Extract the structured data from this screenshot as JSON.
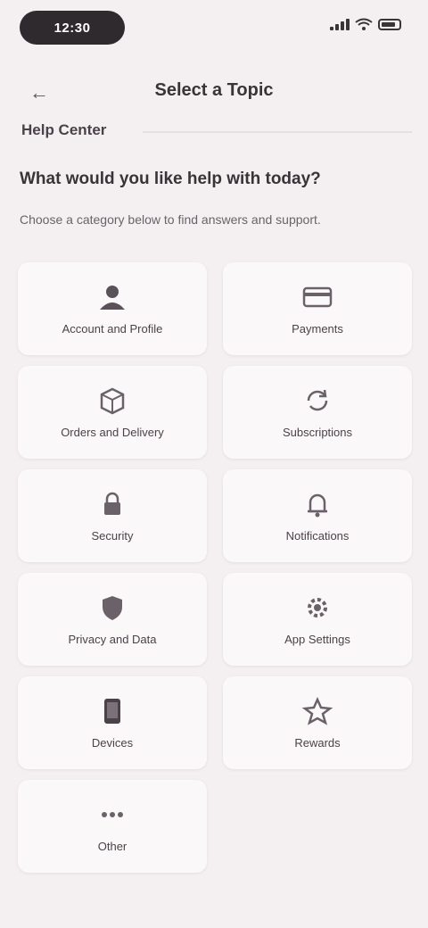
{
  "status": {
    "time": "12:30"
  },
  "nav": {
    "title": "Select a Topic"
  },
  "section": {
    "label": "Help Center"
  },
  "headline": "What would you like help with today?",
  "subline": "Choose a category below to find answers and support.",
  "topics": [
    {
      "label": "Account and Profile",
      "icon": "user-icon"
    },
    {
      "label": "Payments",
      "icon": "card-icon"
    },
    {
      "label": "Orders and Delivery",
      "icon": "box-icon"
    },
    {
      "label": "Subscriptions",
      "icon": "refresh-icon"
    },
    {
      "label": "Security",
      "icon": "lock-icon"
    },
    {
      "label": "Notifications",
      "icon": "bell-icon"
    },
    {
      "label": "Privacy and Data",
      "icon": "shield-icon"
    },
    {
      "label": "App Settings",
      "icon": "gear-icon"
    },
    {
      "label": "Devices",
      "icon": "phone-icon"
    },
    {
      "label": "Rewards",
      "icon": "star-icon"
    },
    {
      "label": "Other",
      "icon": "more-icon"
    }
  ]
}
